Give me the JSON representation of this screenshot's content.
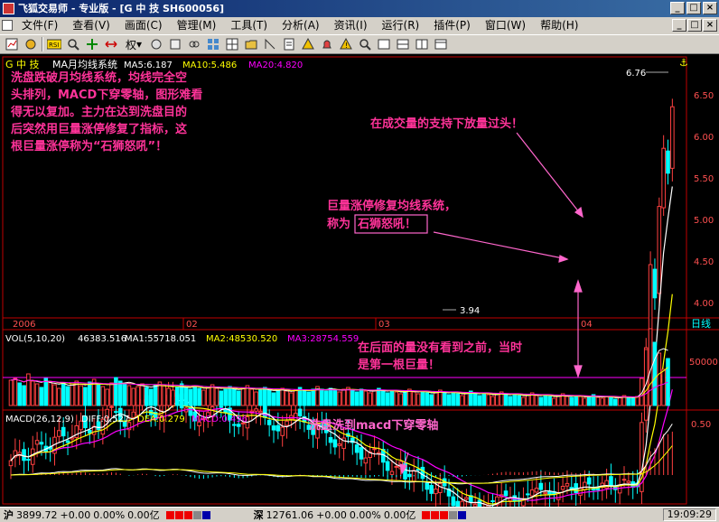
{
  "window": {
    "title": "飞狐交易师 - 专业版 - [G 中  技 SH600056]",
    "buttons": [
      "_",
      "□",
      "×"
    ]
  },
  "menu": [
    "文件(F)",
    "查看(V)",
    "画面(C)",
    "管理(M)",
    "工具(T)",
    "分析(A)",
    "资讯(I)",
    "运行(R)",
    "插件(P)",
    "窗口(W)",
    "帮助(H)"
  ],
  "mdi_buttons": [
    "_",
    "□",
    "×"
  ],
  "toolbar": {
    "weight_label": "权"
  },
  "stock": {
    "name": "G 中  技",
    "indicator": "MA月均线系统",
    "ma5_label": "MA5:6.187",
    "ma10_label": "MA10:5.486",
    "ma20_label": "MA20:4.820",
    "high_label": "6.76",
    "low_label": "3.94"
  },
  "price_axis": [
    "6.50",
    "6.00",
    "5.50",
    "5.00",
    "4.50",
    "4.00"
  ],
  "time_axis": [
    "2006",
    "02",
    "03",
    "04"
  ],
  "period_label": "日线",
  "vol": {
    "label": "VOL(5,10,20)",
    "value": "46383.516",
    "ma1": "MA1:55718.051",
    "ma2": "MA2:48530.520",
    "ma3": "MA3:28754.559",
    "axis": "50000",
    "bars": [
      28,
      30,
      25,
      22,
      35,
      27,
      24,
      20,
      30,
      26,
      23,
      19,
      25,
      21,
      24,
      27,
      22,
      20,
      26,
      29,
      23,
      21,
      18,
      25,
      31,
      27,
      24,
      22,
      19,
      21,
      24,
      20,
      18,
      23,
      26,
      22,
      19,
      17,
      21,
      24,
      20,
      18,
      22,
      19,
      17,
      20,
      23,
      19,
      16,
      18,
      21,
      18,
      16,
      19,
      22,
      18,
      15,
      17,
      20,
      17,
      14,
      16,
      19,
      16,
      14,
      17,
      20,
      17,
      15,
      18,
      21,
      18,
      16,
      19,
      17,
      15,
      18,
      20,
      17,
      15,
      18,
      16,
      14,
      17,
      19,
      16,
      14,
      17,
      15,
      13,
      16,
      18,
      15,
      13,
      16,
      14,
      12,
      15,
      17,
      14,
      12,
      15,
      13,
      11,
      14,
      16,
      13,
      11,
      14,
      12,
      10,
      13,
      15,
      12,
      10,
      13,
      11,
      9,
      12,
      14,
      11,
      9,
      12,
      10,
      8,
      11,
      13,
      10,
      9,
      11,
      10,
      8,
      10,
      12,
      9,
      8,
      10,
      9,
      7,
      9,
      11,
      9,
      8,
      10,
      30,
      62,
      85,
      70,
      58,
      40,
      52
    ]
  },
  "macd": {
    "label": "MACD(26,12,9)",
    "diff": "DIFF:0.527",
    "dea": "DEA:0.279",
    "macd": "MACD:0.496",
    "axis": "0.50"
  },
  "annotations": {
    "a1": "洗盘跌破月均线系统，均线完全空\n头排列，MACD下穿零轴，图形难看\n得无以复加。主力在达到洗盘目的\n后突然用巨量涨停修复了指标，这\n根巨量涨停称为“石狮怒吼”！",
    "a2": "在成交量的支持下放量过头！",
    "a3_line1": "巨量涨停修复均线系统，",
    "a3_prefix": "称为",
    "a3_box": "石狮怒吼！",
    "a4": "在后面的量没有看到之前，当时\n是第一根巨量！",
    "a5": "洗盘洗到macd下穿零轴"
  },
  "status": {
    "sh_label": "沪",
    "sh_index": "3899.72",
    "sh_change": "+0.00",
    "sh_pct": "0.00%",
    "sh_amount": "0.00亿",
    "sz_label": "深",
    "sz_index": "12761.06",
    "sz_change": "+0.00",
    "sz_pct": "0.00%",
    "sz_amount": "0.00亿",
    "time": "19:09:29"
  },
  "colors": {
    "up": "#ff4040",
    "down": "#00ffff",
    "ma5": "#ffffff",
    "ma10": "#ffff00",
    "ma20": "#ff00ff",
    "annotation": "#ff3399",
    "annotation_alt": "#ff66cc"
  }
}
